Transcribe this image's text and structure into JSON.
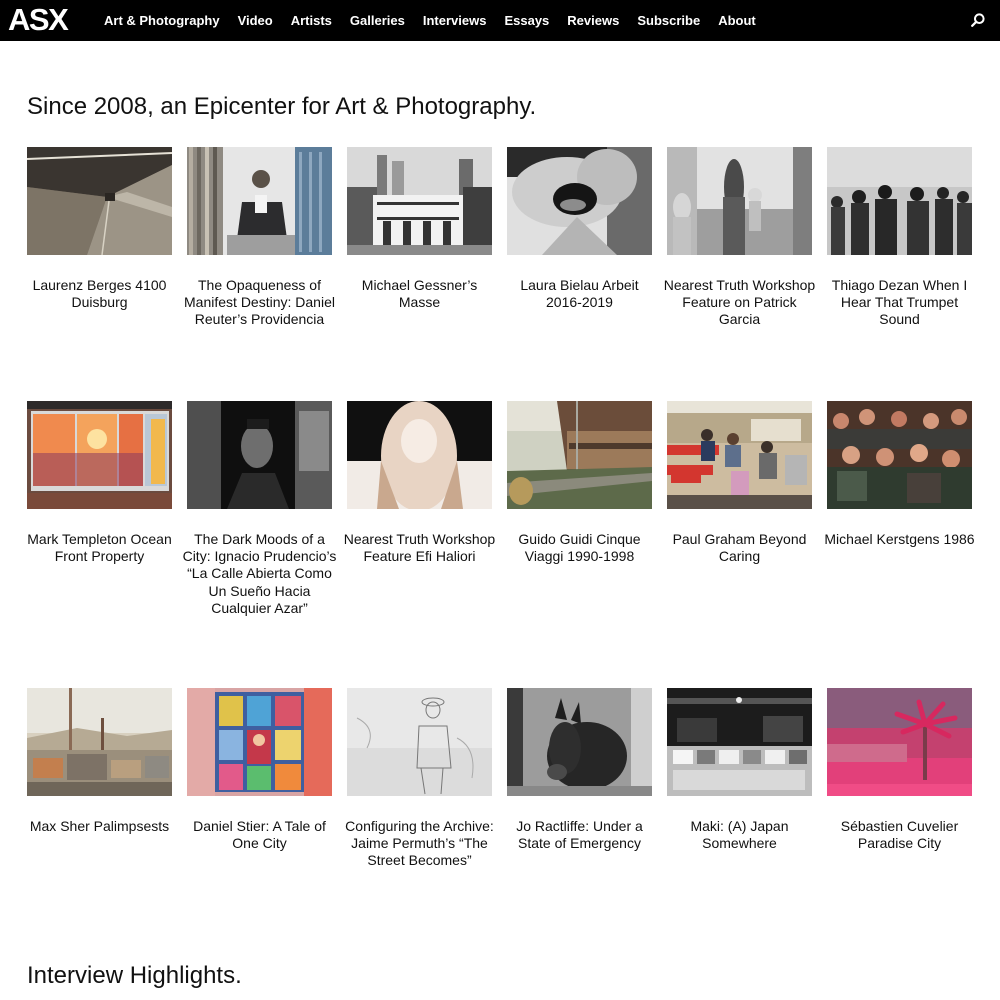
{
  "header": {
    "logo": "ASX",
    "nav": [
      "Art & Photography",
      "Video",
      "Artists",
      "Galleries",
      "Interviews",
      "Essays",
      "Reviews",
      "Subscribe",
      "About"
    ]
  },
  "main": {
    "heading": "Since 2008, an Epicenter for Art & Photography.",
    "rows": [
      [
        {
          "caption": "Laurenz Berges 4100 Duisburg",
          "image": "tunnel-photo"
        },
        {
          "caption": "The Opaqueness of Manifest Destiny: Daniel Reuter’s Providencia",
          "image": "seated-man-photo"
        },
        {
          "caption": "Michael Gessner’s Masse",
          "image": "city-building-photo"
        },
        {
          "caption": "Laura Bielau Arbeit 2016-2019",
          "image": "open-mouth-photo"
        },
        {
          "caption": "Nearest Truth Workshop Feature on Patrick Garcia",
          "image": "woman-child-beach-photo"
        },
        {
          "caption": "Thiago Dezan When I Hear That Trumpet Sound",
          "image": "masked-crowd-photo"
        }
      ],
      [
        {
          "caption": "Mark Templeton Ocean Front Property",
          "image": "sunset-window-photo"
        },
        {
          "caption": "The Dark Moods of a City: Ignacio Prudencio’s “La Calle Abierta Como Un Sueño Hacia Cualquier Azar”",
          "image": "portrait-man-photo"
        },
        {
          "caption": "Nearest Truth Workshop Feature Efi Haliori",
          "image": "blonde-hair-photo"
        },
        {
          "caption": "Guido Guidi Cinque Viaggi 1990-1998",
          "image": "railway-photo"
        },
        {
          "caption": "Paul Graham Beyond Caring",
          "image": "waiting-room-photo"
        },
        {
          "caption": "Michael Kerstgens 1986",
          "image": "youth-group-photo"
        }
      ],
      [
        {
          "caption": "Max Sher Palimpsests",
          "image": "industrial-landscape-photo"
        },
        {
          "caption": "Daniel Stier: A Tale of One City",
          "image": "religious-posters-photo"
        },
        {
          "caption": "Configuring the Archive: Jaime Permuth’s “The Street Becomes”",
          "image": "sketch-man-photo"
        },
        {
          "caption": "Jo Ractliffe: Under a State of Emergency",
          "image": "donkey-photo"
        },
        {
          "caption": "Maki: (A) Japan Somewhere",
          "image": "market-stall-photo"
        },
        {
          "caption": "Sébastien Cuvelier Paradise City",
          "image": "pink-palm-photo"
        }
      ]
    ],
    "section2_heading": "Interview Highlights."
  }
}
